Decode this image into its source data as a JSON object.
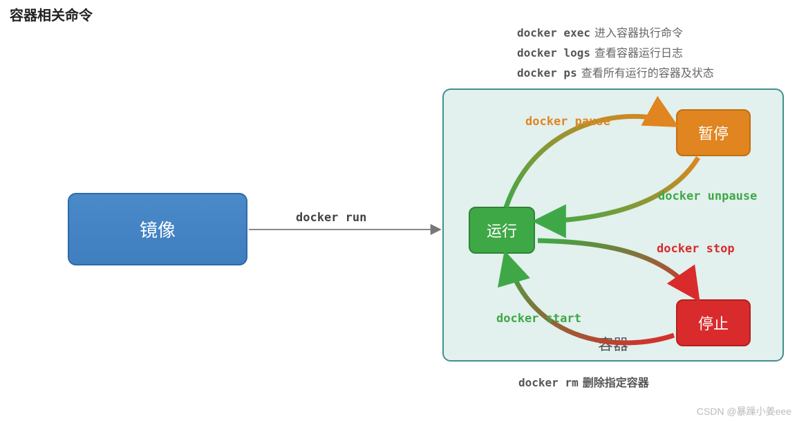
{
  "title": "容器相关命令",
  "top_commands": [
    {
      "cmd": "docker exec",
      "desc": "进入容器执行命令"
    },
    {
      "cmd": "docker logs",
      "desc": "查看容器运行日志"
    },
    {
      "cmd": "docker ps",
      "desc": "查看所有运行的容器及状态"
    }
  ],
  "nodes": {
    "image": {
      "label": "镜像"
    },
    "container": {
      "label": "容器"
    },
    "run": {
      "label": "运行"
    },
    "pause": {
      "label": "暂停"
    },
    "stop": {
      "label": "停止"
    }
  },
  "edges": {
    "image_to_run": {
      "label": "docker run",
      "from": "image",
      "to": "run"
    },
    "pause": {
      "label": "docker pause",
      "from": "run",
      "to": "pause"
    },
    "unpause": {
      "label": "docker unpause",
      "from": "pause",
      "to": "run"
    },
    "stop": {
      "label": "docker stop",
      "from": "run",
      "to": "stop"
    },
    "start": {
      "label": "docker start",
      "from": "stop",
      "to": "run"
    }
  },
  "bottom_command": {
    "cmd": "docker rm",
    "desc": "删除指定容器"
  },
  "watermark": "CSDN @暴躁小姜eee",
  "colors": {
    "image_box": "#3f7ebf",
    "container_box": "#e2f0ee",
    "run": "#3fa846",
    "pause": "#e0851f",
    "stop": "#d92b2b"
  }
}
